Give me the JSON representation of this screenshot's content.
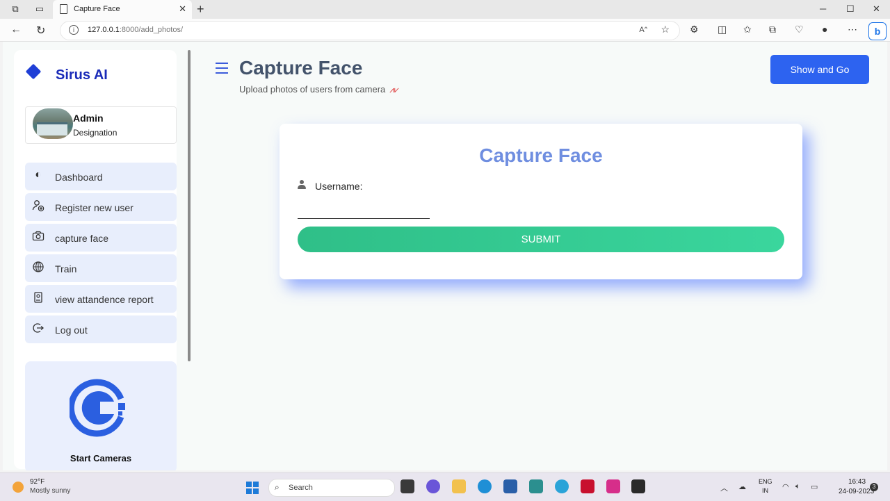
{
  "browser": {
    "tab_title": "Capture Face",
    "url_host": "127.0.0.1",
    "url_rest": ":8000/add_photos/"
  },
  "sidebar": {
    "brand": "Sirus AI",
    "profile": {
      "name": "Admin",
      "designation": "Designation"
    },
    "items": [
      {
        "label": "Dashboard",
        "icon": "half-circle-icon"
      },
      {
        "label": "Register new user",
        "icon": "user-add-icon"
      },
      {
        "label": "capture face",
        "icon": "camera-icon"
      },
      {
        "label": "Train",
        "icon": "globe-icon"
      },
      {
        "label": "view attandence report",
        "icon": "id-badge-icon"
      },
      {
        "label": "Log out",
        "icon": "logout-icon"
      }
    ],
    "camera_card_label": "Start Cameras"
  },
  "header": {
    "title": "Capture Face",
    "subtitle": "Upload photos of users from camera",
    "action_button": "Show and Go"
  },
  "form": {
    "title": "Capture Face",
    "username_label": "Username:",
    "username_value": "",
    "submit_label": "SUBMIT"
  },
  "taskbar": {
    "temp": "92°F",
    "weather": "Mostly sunny",
    "search_placeholder": "Search",
    "lang_top": "ENG",
    "lang_bottom": "IN",
    "time": "16:43",
    "date": "24-09-2023",
    "notifications": "3"
  },
  "colors": {
    "accent": "#2d63f0",
    "brand": "#1a2bb8",
    "submit": "#34cc93",
    "card_title": "#6f8ee0"
  }
}
